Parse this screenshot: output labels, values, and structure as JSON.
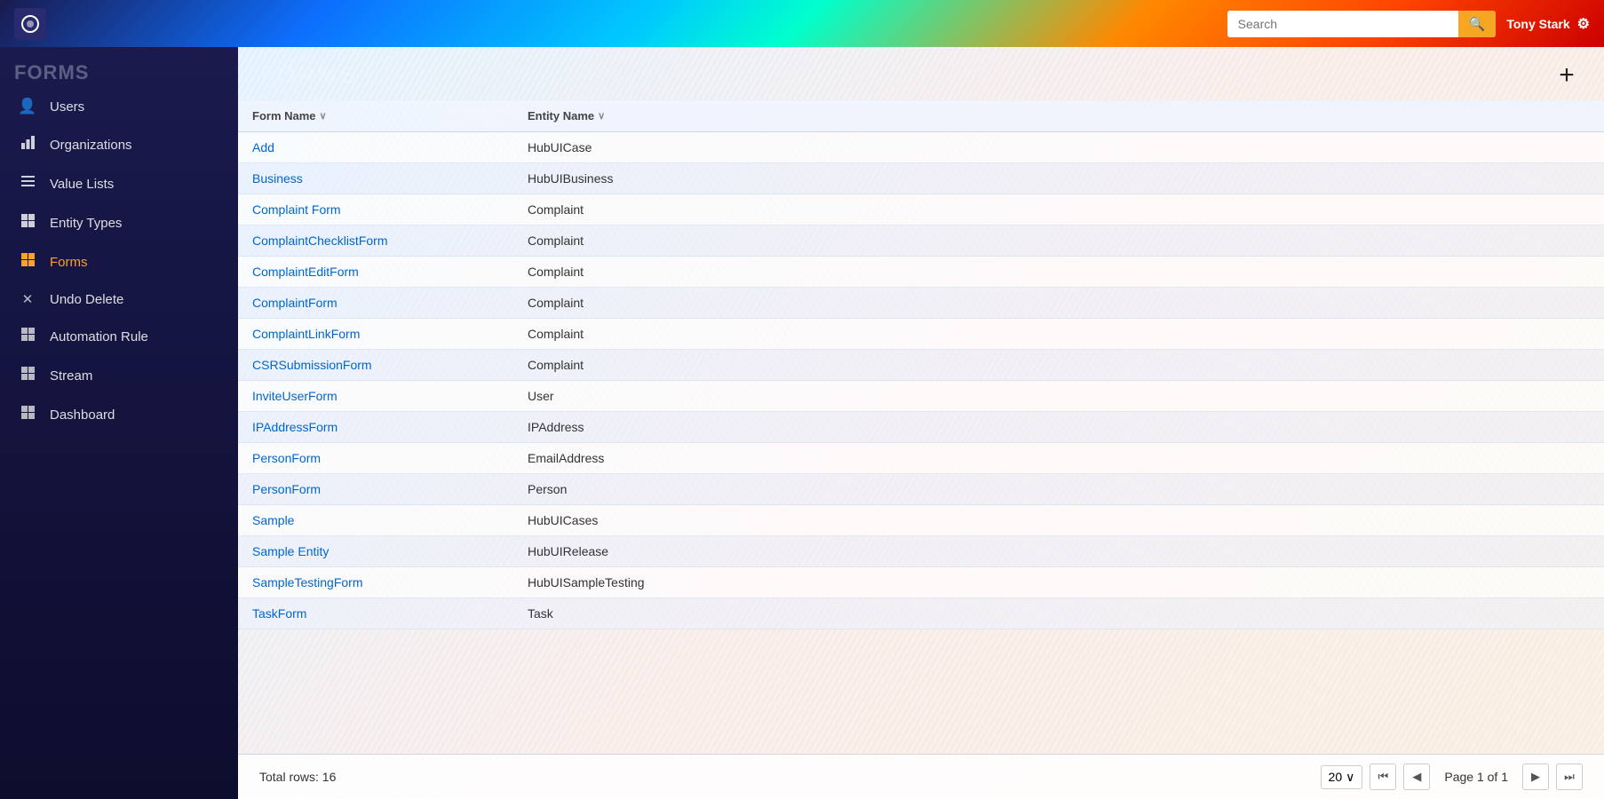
{
  "header": {
    "search_placeholder": "Search",
    "user_name": "Tony Stark",
    "logo_icon": "⚙"
  },
  "sidebar": {
    "title": "FORMS",
    "items": [
      {
        "id": "users",
        "label": "Users",
        "icon": "👤"
      },
      {
        "id": "organizations",
        "label": "Organizations",
        "icon": "📊"
      },
      {
        "id": "value-lists",
        "label": "Value Lists",
        "icon": "≡"
      },
      {
        "id": "entity-types",
        "label": "Entity Types",
        "icon": "📅"
      },
      {
        "id": "forms",
        "label": "Forms",
        "icon": "⊞",
        "active": true
      },
      {
        "id": "undo-delete",
        "label": "Undo Delete",
        "icon": "✕"
      },
      {
        "id": "automation-rule",
        "label": "Automation Rule",
        "icon": "📅"
      },
      {
        "id": "stream",
        "label": "Stream",
        "icon": "📅"
      },
      {
        "id": "dashboard",
        "label": "Dashboard",
        "icon": "⊞"
      }
    ]
  },
  "page": {
    "title": "FORMS",
    "add_button_label": "+"
  },
  "table": {
    "columns": [
      {
        "id": "form_name",
        "label": "Form Name"
      },
      {
        "id": "entity_name",
        "label": "Entity Name"
      }
    ],
    "rows": [
      {
        "form_name": "Add",
        "entity_name": "HubUICase"
      },
      {
        "form_name": "Business",
        "entity_name": "HubUIBusiness"
      },
      {
        "form_name": "Complaint Form",
        "entity_name": "Complaint"
      },
      {
        "form_name": "ComplaintChecklistForm",
        "entity_name": "Complaint"
      },
      {
        "form_name": "ComplaintEditForm",
        "entity_name": "Complaint"
      },
      {
        "form_name": "ComplaintForm",
        "entity_name": "Complaint"
      },
      {
        "form_name": "ComplaintLinkForm",
        "entity_name": "Complaint"
      },
      {
        "form_name": "CSRSubmissionForm",
        "entity_name": "Complaint"
      },
      {
        "form_name": "InviteUserForm",
        "entity_name": "User"
      },
      {
        "form_name": "IPAddressForm",
        "entity_name": "IPAddress"
      },
      {
        "form_name": "PersonForm",
        "entity_name": "EmailAddress"
      },
      {
        "form_name": "PersonForm",
        "entity_name": "Person"
      },
      {
        "form_name": "Sample",
        "entity_name": "HubUICases"
      },
      {
        "form_name": "Sample Entity",
        "entity_name": "HubUIRelease"
      },
      {
        "form_name": "SampleTestingForm",
        "entity_name": "HubUISampleTesting"
      },
      {
        "form_name": "TaskForm",
        "entity_name": "Task"
      }
    ]
  },
  "pagination": {
    "total_rows_label": "Total rows: 16",
    "page_size": "20",
    "page_info": "Page 1 of 1",
    "first_icon": "⏮",
    "prev_icon": "◀",
    "next_icon": "▶",
    "last_icon": "⏭"
  }
}
